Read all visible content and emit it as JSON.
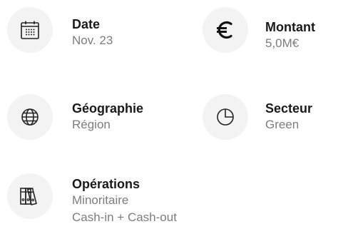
{
  "items": {
    "date": {
      "title": "Date",
      "value": "Nov. 23",
      "icon": "calendar-icon"
    },
    "montant": {
      "title": "Montant",
      "value": "5,0M€",
      "icon": "euro-icon"
    },
    "geographie": {
      "title": "Géographie",
      "value": "Région",
      "icon": "globe-icon"
    },
    "secteur": {
      "title": "Secteur",
      "value": "Green",
      "icon": "pie-chart-icon"
    },
    "operations": {
      "title": "Opérations",
      "values": [
        "Minoritaire",
        "Cash-in + Cash-out"
      ],
      "icon": "binders-icon"
    }
  },
  "colors": {
    "title": "#1a1a1a",
    "subtitle": "#7d7d7d",
    "icon_bg": "#f3f3f3",
    "icon_stroke": "#222222"
  }
}
